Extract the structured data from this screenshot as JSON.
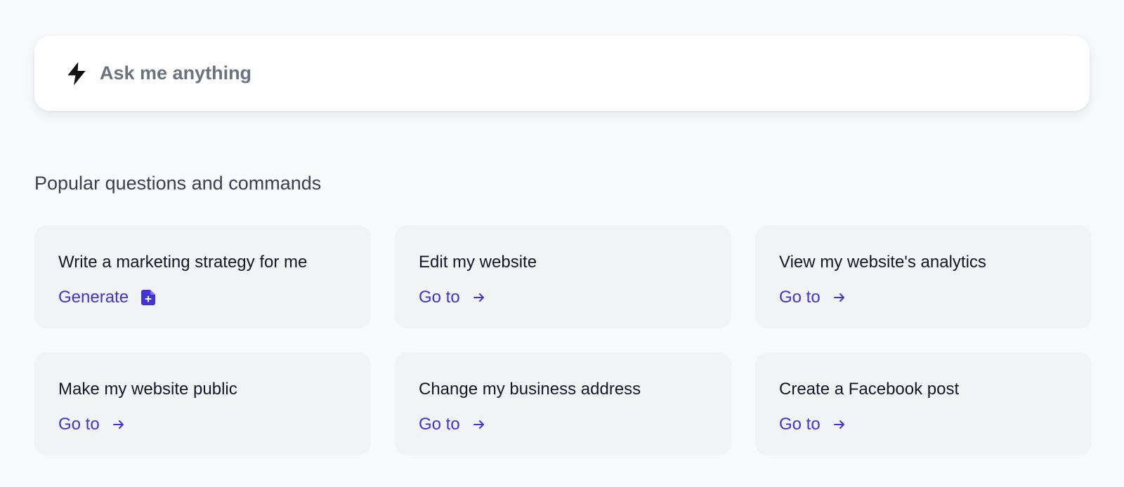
{
  "search": {
    "placeholder": "Ask me anything",
    "icon": "bolt-icon"
  },
  "section": {
    "title": "Popular questions and commands"
  },
  "colors": {
    "accent": "#4332d6",
    "card_bg": "#f2f3f5",
    "page_bg": "#f8f9fb"
  },
  "cards": [
    {
      "title": "Write a marketing strategy for me",
      "action": "Generate",
      "icon": "document-plus-icon"
    },
    {
      "title": "Edit my website",
      "action": "Go to",
      "icon": "arrow-right-icon"
    },
    {
      "title": "View my website's analytics",
      "action": "Go to",
      "icon": "arrow-right-icon"
    },
    {
      "title": "Make my website public",
      "action": "Go to",
      "icon": "arrow-right-icon"
    },
    {
      "title": "Change my business address",
      "action": "Go to",
      "icon": "arrow-right-icon"
    },
    {
      "title": "Create a Facebook post",
      "action": "Go to",
      "icon": "arrow-right-icon"
    }
  ]
}
